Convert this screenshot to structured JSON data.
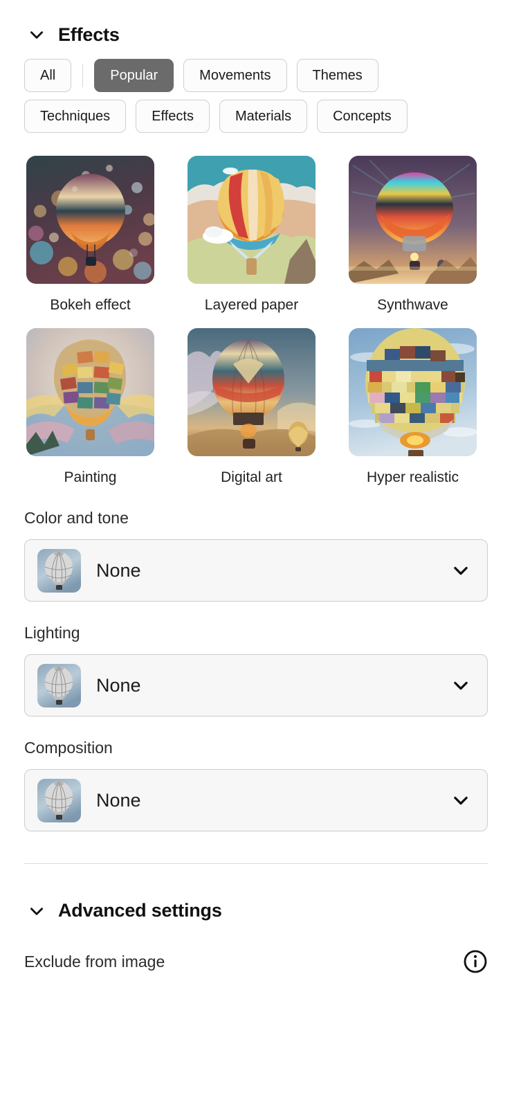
{
  "section": {
    "title": "Effects",
    "collapse_icon": "chevron-down-icon"
  },
  "filters": {
    "chips": [
      {
        "label": "All",
        "selected": false
      },
      {
        "label": "Popular",
        "selected": true
      },
      {
        "label": "Movements",
        "selected": false
      },
      {
        "label": "Themes",
        "selected": false
      },
      {
        "label": "Techniques",
        "selected": false
      },
      {
        "label": "Effects",
        "selected": false
      },
      {
        "label": "Materials",
        "selected": false
      },
      {
        "label": "Concepts",
        "selected": false
      }
    ],
    "selected_chip": "Popular",
    "selected_bg": "#6b6b6b",
    "selected_fg": "#ffffff",
    "chip_border": "#cfcfcf"
  },
  "presets": [
    {
      "label": "Bokeh effect",
      "thumb": "bokeh-effect-thumbnail"
    },
    {
      "label": "Layered paper",
      "thumb": "layered-paper-thumbnail"
    },
    {
      "label": "Synthwave",
      "thumb": "synthwave-thumbnail"
    },
    {
      "label": "Painting",
      "thumb": "painting-thumbnail"
    },
    {
      "label": "Digital art",
      "thumb": "digital-art-thumbnail"
    },
    {
      "label": "Hyper realistic",
      "thumb": "hyper-realistic-thumbnail"
    }
  ],
  "dropdowns": [
    {
      "label": "Color and tone",
      "value": "None",
      "thumb": "balloon-grayscale-thumbnail",
      "chevron": "chevron-down-icon"
    },
    {
      "label": "Lighting",
      "value": "None",
      "thumb": "balloon-grayscale-thumbnail",
      "chevron": "chevron-down-icon"
    },
    {
      "label": "Composition",
      "value": "None",
      "thumb": "balloon-grayscale-thumbnail",
      "chevron": "chevron-down-icon"
    }
  ],
  "advanced": {
    "title": "Advanced settings",
    "collapse_icon": "chevron-down-icon",
    "exclude_label": "Exclude from image",
    "info_icon": "info-circle-icon"
  }
}
